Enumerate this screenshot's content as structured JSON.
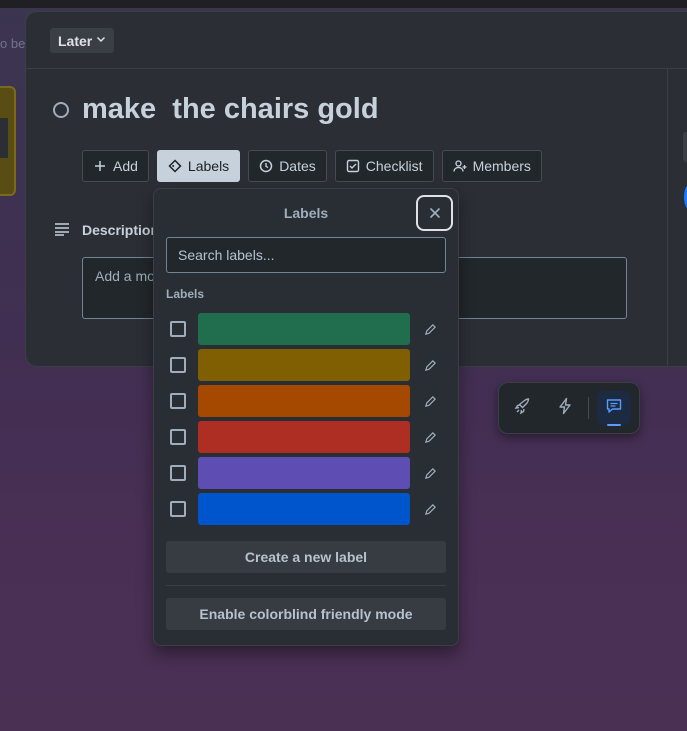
{
  "background": {
    "board_text": "o be"
  },
  "modal": {
    "list_name": "Later",
    "card_title": "make  the chairs gold",
    "actions": [
      {
        "label": "Add",
        "icon": "plus-icon"
      },
      {
        "label": "Labels",
        "icon": "tag-icon"
      },
      {
        "label": "Dates",
        "icon": "clock-icon"
      },
      {
        "label": "Checklist",
        "icon": "checkbox-icon"
      },
      {
        "label": "Members",
        "icon": "add-member-icon"
      }
    ],
    "description": {
      "label": "Description",
      "placeholder": "Add a mo"
    }
  },
  "labels_popover": {
    "title": "Labels",
    "search_placeholder": "Search labels...",
    "section_label": "Labels",
    "labels": [
      {
        "color": "#216e4e",
        "checked": false
      },
      {
        "color": "#7f5f01",
        "checked": false
      },
      {
        "color": "#a54800",
        "checked": false
      },
      {
        "color": "#ae2e24",
        "checked": false
      },
      {
        "color": "#5e4db2",
        "checked": false
      },
      {
        "color": "#0055cc",
        "checked": false
      }
    ],
    "create_label": "Create a new label",
    "colorblind_label": "Enable colorblind friendly mode"
  },
  "toolbar": {
    "items": [
      "rocket-icon",
      "lightning-icon",
      "comment-icon"
    ],
    "active": "comment-icon",
    "accent": "#579dff"
  }
}
